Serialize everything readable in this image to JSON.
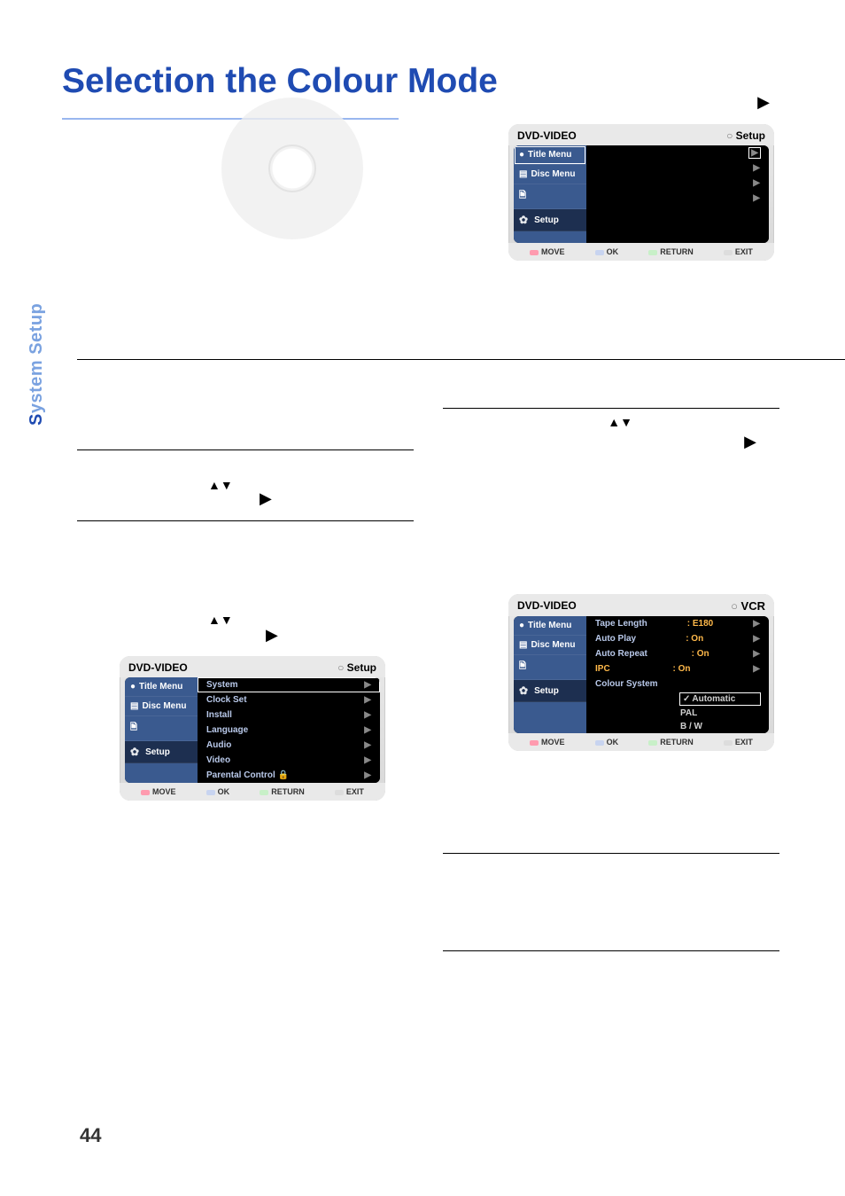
{
  "page_title": "Selection the Colour Mode",
  "sidebar_tab": "System Setup",
  "page_number": "44",
  "symbols": {
    "updown": "▲▼",
    "right": "▶"
  },
  "osd_common": {
    "header_left": "DVD-VIDEO",
    "side_items": [
      "Title Menu",
      "Disc Menu",
      "",
      "Setup"
    ],
    "footer": {
      "move": "MOVE",
      "ok": "OK",
      "return": "RETURN",
      "exit": "EXIT"
    }
  },
  "osd1": {
    "header_right": "Setup",
    "rows": []
  },
  "osd2": {
    "header_right": "Setup",
    "rows": [
      {
        "label": "System",
        "selected": true
      },
      {
        "label": "Clock Set"
      },
      {
        "label": "Install"
      },
      {
        "label": "Language"
      },
      {
        "label": "Audio"
      },
      {
        "label": "Video"
      },
      {
        "label": "Parental Control",
        "lock": true
      }
    ]
  },
  "osd3": {
    "header_right": "VCR",
    "rows": [
      {
        "label": "Tape Length",
        "val": ": E180"
      },
      {
        "label": "Auto Play",
        "val": ": On"
      },
      {
        "label": "Auto Repeat",
        "val": ": On"
      },
      {
        "label": "IPC",
        "val": ": On",
        "hl": true
      },
      {
        "label": "Colour System",
        "val": "",
        "selected_val": "Automatic"
      }
    ],
    "sub_options": [
      "Automatic",
      "PAL",
      "B / W"
    ]
  }
}
